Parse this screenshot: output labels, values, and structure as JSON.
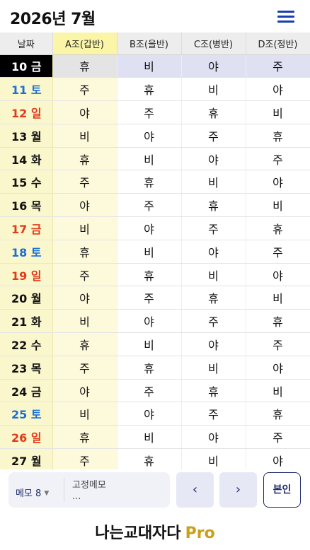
{
  "header": {
    "title": "2026년 7월"
  },
  "columns": [
    "날짜",
    "A조(갑반)",
    "B조(을반)",
    "C조(병반)",
    "D조(정반)"
  ],
  "rows": [
    {
      "date": "10 금",
      "day": "weekday",
      "today": true,
      "shifts": [
        "휴",
        "비",
        "야",
        "주"
      ]
    },
    {
      "date": "11 토",
      "day": "sat",
      "today": false,
      "shifts": [
        "주",
        "휴",
        "비",
        "야"
      ]
    },
    {
      "date": "12 일",
      "day": "sun",
      "today": false,
      "shifts": [
        "야",
        "주",
        "휴",
        "비"
      ]
    },
    {
      "date": "13 월",
      "day": "weekday",
      "today": false,
      "shifts": [
        "비",
        "야",
        "주",
        "휴"
      ]
    },
    {
      "date": "14 화",
      "day": "weekday",
      "today": false,
      "shifts": [
        "휴",
        "비",
        "야",
        "주"
      ]
    },
    {
      "date": "15 수",
      "day": "weekday",
      "today": false,
      "shifts": [
        "주",
        "휴",
        "비",
        "야"
      ]
    },
    {
      "date": "16 목",
      "day": "weekday",
      "today": false,
      "shifts": [
        "야",
        "주",
        "휴",
        "비"
      ]
    },
    {
      "date": "17 금",
      "day": "sun",
      "today": false,
      "shifts": [
        "비",
        "야",
        "주",
        "휴"
      ]
    },
    {
      "date": "18 토",
      "day": "sat",
      "today": false,
      "shifts": [
        "휴",
        "비",
        "야",
        "주"
      ]
    },
    {
      "date": "19 일",
      "day": "sun",
      "today": false,
      "shifts": [
        "주",
        "휴",
        "비",
        "야"
      ]
    },
    {
      "date": "20 월",
      "day": "weekday",
      "today": false,
      "shifts": [
        "야",
        "주",
        "휴",
        "비"
      ]
    },
    {
      "date": "21 화",
      "day": "weekday",
      "today": false,
      "shifts": [
        "비",
        "야",
        "주",
        "휴"
      ]
    },
    {
      "date": "22 수",
      "day": "weekday",
      "today": false,
      "shifts": [
        "휴",
        "비",
        "야",
        "주"
      ]
    },
    {
      "date": "23 목",
      "day": "weekday",
      "today": false,
      "shifts": [
        "주",
        "휴",
        "비",
        "야"
      ]
    },
    {
      "date": "24 금",
      "day": "weekday",
      "today": false,
      "shifts": [
        "야",
        "주",
        "휴",
        "비"
      ]
    },
    {
      "date": "25 토",
      "day": "sat",
      "today": false,
      "shifts": [
        "비",
        "야",
        "주",
        "휴"
      ]
    },
    {
      "date": "26 일",
      "day": "sun",
      "today": false,
      "shifts": [
        "휴",
        "비",
        "야",
        "주"
      ]
    },
    {
      "date": "27 월",
      "day": "weekday",
      "today": false,
      "shifts": [
        "주",
        "휴",
        "비",
        "야"
      ]
    }
  ],
  "memo": {
    "selector": "메모 8",
    "label": "고정메모",
    "preview": "..."
  },
  "nav": {
    "prev": "‹",
    "next": "›",
    "self": "본인"
  },
  "brand": {
    "name": "나는교대자다",
    "pro": "Pro"
  },
  "colors": {
    "accent": "#1e2a6a",
    "rest": "#d01818",
    "day_shift": "#1a2fd0",
    "saturday": "#1a6fd8",
    "sunday": "#e03a1a",
    "pro_gold": "#c9a01a",
    "highlight_col": "#fbf5a8"
  }
}
